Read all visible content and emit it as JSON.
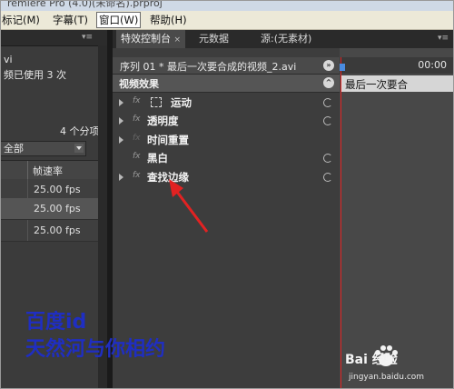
{
  "window": {
    "title": "remiere Pro (4.0)(未命名).prproj"
  },
  "menubar": {
    "items": [
      {
        "label": "标记(M)"
      },
      {
        "label": "字幕(T)"
      },
      {
        "label": "窗口(W)"
      },
      {
        "label": "帮助(H)"
      }
    ],
    "selected": "窗口(W)"
  },
  "project_panel": {
    "clip_name": "vi",
    "usage": "频已使用 3 次",
    "item_count": "4 个分项",
    "filter": "全部",
    "column_header": "帧速率",
    "frame_rates": [
      "25.00 fps",
      "25.00 fps",
      "25.00 fps"
    ]
  },
  "tabs": [
    {
      "label": "特效控制台",
      "active": true
    },
    {
      "label": "元数据",
      "active": false
    },
    {
      "label": "源:(无素材)",
      "active": false
    }
  ],
  "effect_controls": {
    "sequence_label": "序列 01 * 最后一次要合成的视频_2.avi",
    "section_title": "视频效果",
    "effects": [
      {
        "name": "运动",
        "expandable": true,
        "fx_enabled": true,
        "resettable": true
      },
      {
        "name": "透明度",
        "expandable": true,
        "fx_enabled": true,
        "resettable": true
      },
      {
        "name": "时间重置",
        "expandable": true,
        "fx_enabled": false,
        "resettable": false
      },
      {
        "name": "黑白",
        "expandable": false,
        "fx_enabled": true,
        "resettable": true
      },
      {
        "name": "查找边缘",
        "expandable": true,
        "fx_enabled": true,
        "resettable": true
      }
    ]
  },
  "timeline": {
    "timecode": "00:00",
    "clip_label": "最后一次要合"
  },
  "watermarks": {
    "line1": "百度id",
    "line2": "天然河与你相约",
    "baidu": "Bai 经验",
    "baidu_url": "jingyan.baidu.com"
  },
  "colors": {
    "accent_red": "#e22222",
    "watermark_blue": "#1f2ec2",
    "panel_bg": "#3d3d3d"
  }
}
